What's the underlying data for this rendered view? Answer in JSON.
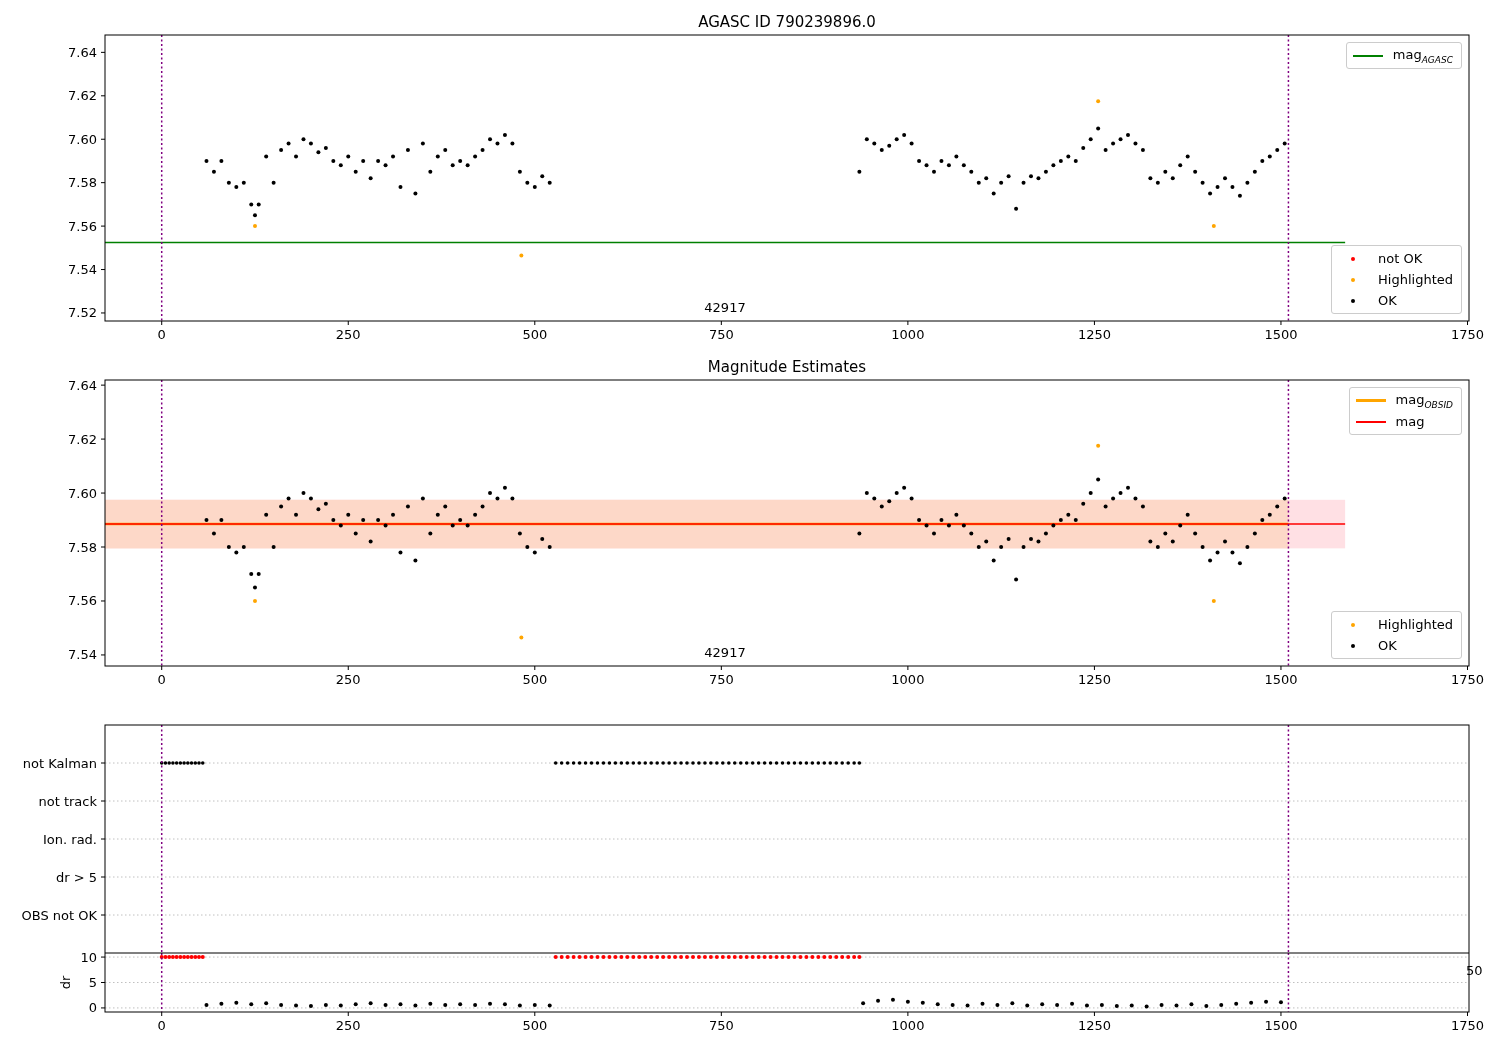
{
  "charts": [
    {
      "chart_data": {
        "type": "scatter",
        "title": "AGASC ID 790239896.0",
        "xlim": [
          -76,
          1752
        ],
        "ylim": [
          7.5163,
          7.648
        ],
        "xticks": [
          0,
          250,
          500,
          750,
          1000,
          1250,
          1500,
          1750
        ],
        "yticks": [
          {
            "value": 7.52,
            "label": "7.52"
          },
          {
            "value": 7.54,
            "label": "7.54"
          },
          {
            "value": 7.56,
            "label": "7.56"
          },
          {
            "value": 7.58,
            "label": "7.58"
          },
          {
            "value": 7.6,
            "label": "7.60"
          },
          {
            "value": 7.62,
            "label": "7.62"
          },
          {
            "value": 7.64,
            "label": "7.64"
          }
        ],
        "ref_lines": [
          {
            "axis": "y",
            "value": 7.5525,
            "label": "mag$_{AGASC}$",
            "color": "#008000"
          },
          {
            "axis": "x",
            "value": 0,
            "color": "#800080"
          },
          {
            "axis": "x",
            "value": 1510,
            "color": "#800080"
          }
        ],
        "series": [
          {
            "name": "not OK",
            "color": "#ff0000"
          },
          {
            "name": "Highlighted",
            "color": "#ffa500",
            "x": [
              125,
              482,
              1255,
              1410
            ],
            "values": [
              7.56,
              7.5465,
              7.6175,
              7.56
            ]
          },
          {
            "name": "OK",
            "color": "#000000",
            "x": [
              60,
              70,
              80,
              90,
              100,
              110,
              120,
              125,
              130,
              140,
              150,
              160,
              170,
              180,
              190,
              200,
              210,
              220,
              230,
              240,
              250,
              260,
              270,
              280,
              290,
              300,
              310,
              320,
              330,
              340,
              350,
              360,
              370,
              380,
              390,
              400,
              410,
              420,
              430,
              440,
              450,
              460,
              470,
              480,
              490,
              500,
              510,
              520,
              935,
              945,
              955,
              965,
              975,
              985,
              995,
              1005,
              1015,
              1025,
              1035,
              1045,
              1055,
              1065,
              1075,
              1085,
              1095,
              1105,
              1115,
              1125,
              1135,
              1145,
              1155,
              1165,
              1175,
              1185,
              1195,
              1205,
              1215,
              1225,
              1235,
              1245,
              1255,
              1265,
              1275,
              1285,
              1295,
              1305,
              1315,
              1325,
              1335,
              1345,
              1355,
              1365,
              1375,
              1385,
              1395,
              1405,
              1415,
              1425,
              1435,
              1445,
              1455,
              1465,
              1475,
              1485,
              1495,
              1505
            ],
            "values": [
              7.59,
              7.585,
              7.59,
              7.58,
              7.578,
              7.58,
              7.57,
              7.565,
              7.57,
              7.592,
              7.58,
              7.595,
              7.598,
              7.592,
              7.6,
              7.598,
              7.594,
              7.596,
              7.59,
              7.588,
              7.592,
              7.585,
              7.59,
              7.582,
              7.59,
              7.588,
              7.592,
              7.578,
              7.595,
              7.575,
              7.598,
              7.585,
              7.592,
              7.595,
              7.588,
              7.59,
              7.588,
              7.592,
              7.595,
              7.6,
              7.598,
              7.602,
              7.598,
              7.585,
              7.58,
              7.578,
              7.583,
              7.58,
              7.585,
              7.6,
              7.598,
              7.595,
              7.597,
              7.6,
              7.602,
              7.598,
              7.59,
              7.588,
              7.585,
              7.59,
              7.588,
              7.592,
              7.588,
              7.585,
              7.58,
              7.582,
              7.575,
              7.58,
              7.583,
              7.568,
              7.58,
              7.583,
              7.582,
              7.585,
              7.588,
              7.59,
              7.592,
              7.59,
              7.596,
              7.6,
              7.605,
              7.595,
              7.598,
              7.6,
              7.602,
              7.598,
              7.595,
              7.582,
              7.58,
              7.585,
              7.582,
              7.588,
              7.592,
              7.585,
              7.58,
              7.575,
              7.578,
              7.582,
              7.578,
              7.574,
              7.58,
              7.585,
              7.59,
              7.592,
              7.595,
              7.598
            ]
          }
        ],
        "annotations": [
          "42917"
        ]
      }
    },
    {
      "chart_data": {
        "type": "scatter",
        "title": "Magnitude Estimates",
        "xlim": [
          -76,
          1752
        ],
        "ylim": [
          7.5359,
          7.6419
        ],
        "xticks": [
          0,
          250,
          500,
          750,
          1000,
          1250,
          1500,
          1750
        ],
        "yticks": [
          {
            "value": 7.54,
            "label": "7.54"
          },
          {
            "value": 7.56,
            "label": "7.56"
          },
          {
            "value": 7.58,
            "label": "7.58"
          },
          {
            "value": 7.6,
            "label": "7.60"
          },
          {
            "value": 7.62,
            "label": "7.62"
          },
          {
            "value": 7.64,
            "label": "7.64"
          }
        ],
        "ref_lines": [
          {
            "axis": "y",
            "value": 7.5885,
            "label": "mag$_{OBSID}$",
            "color": "#ffa500"
          },
          {
            "axis": "y",
            "value": 7.5885,
            "label": "mag",
            "color": "#ff0000"
          },
          {
            "axis": "x",
            "value": 0,
            "color": "#800080"
          },
          {
            "axis": "x",
            "value": 1510,
            "color": "#800080"
          }
        ],
        "bands": [
          {
            "axis": "y",
            "from": 7.5795,
            "to": 7.5975,
            "color": "#ffe0e4"
          },
          {
            "axis": "y",
            "from": 7.5795,
            "to": 7.5975,
            "color": "#fdd8c8"
          }
        ],
        "series": [
          {
            "name": "Highlighted",
            "color": "#ffa500",
            "x": [
              125,
              482,
              1255,
              1410
            ],
            "values": [
              7.56,
              7.5465,
              7.6175,
              7.56
            ]
          },
          {
            "name": "OK",
            "color": "#000000",
            "x": [
              60,
              70,
              80,
              90,
              100,
              110,
              120,
              125,
              130,
              140,
              150,
              160,
              170,
              180,
              190,
              200,
              210,
              220,
              230,
              240,
              250,
              260,
              270,
              280,
              290,
              300,
              310,
              320,
              330,
              340,
              350,
              360,
              370,
              380,
              390,
              400,
              410,
              420,
              430,
              440,
              450,
              460,
              470,
              480,
              490,
              500,
              510,
              520,
              935,
              945,
              955,
              965,
              975,
              985,
              995,
              1005,
              1015,
              1025,
              1035,
              1045,
              1055,
              1065,
              1075,
              1085,
              1095,
              1105,
              1115,
              1125,
              1135,
              1145,
              1155,
              1165,
              1175,
              1185,
              1195,
              1205,
              1215,
              1225,
              1235,
              1245,
              1255,
              1265,
              1275,
              1285,
              1295,
              1305,
              1315,
              1325,
              1335,
              1345,
              1355,
              1365,
              1375,
              1385,
              1395,
              1405,
              1415,
              1425,
              1435,
              1445,
              1455,
              1465,
              1475,
              1485,
              1495,
              1505
            ],
            "values": [
              7.59,
              7.585,
              7.59,
              7.58,
              7.578,
              7.58,
              7.57,
              7.565,
              7.57,
              7.592,
              7.58,
              7.595,
              7.598,
              7.592,
              7.6,
              7.598,
              7.594,
              7.596,
              7.59,
              7.588,
              7.592,
              7.585,
              7.59,
              7.582,
              7.59,
              7.588,
              7.592,
              7.578,
              7.595,
              7.575,
              7.598,
              7.585,
              7.592,
              7.595,
              7.588,
              7.59,
              7.588,
              7.592,
              7.595,
              7.6,
              7.598,
              7.602,
              7.598,
              7.585,
              7.58,
              7.578,
              7.583,
              7.58,
              7.585,
              7.6,
              7.598,
              7.595,
              7.597,
              7.6,
              7.602,
              7.598,
              7.59,
              7.588,
              7.585,
              7.59,
              7.588,
              7.592,
              7.588,
              7.585,
              7.58,
              7.582,
              7.575,
              7.58,
              7.583,
              7.568,
              7.58,
              7.583,
              7.582,
              7.585,
              7.588,
              7.59,
              7.592,
              7.59,
              7.596,
              7.6,
              7.605,
              7.595,
              7.598,
              7.6,
              7.602,
              7.598,
              7.595,
              7.582,
              7.58,
              7.585,
              7.582,
              7.588,
              7.592,
              7.585,
              7.58,
              7.575,
              7.578,
              7.582,
              7.578,
              7.574,
              7.58,
              7.585,
              7.59,
              7.592,
              7.595,
              7.598
            ]
          }
        ],
        "annotations": [
          "42917"
        ]
      }
    },
    {
      "flag_rows": [
        "not Kalman",
        "not track",
        "Ion. rad.",
        "dr > 5",
        "OBS not OK"
      ]
    },
    {
      "chart_data": {
        "type": "scatter",
        "grid": true,
        "ylabel": "dr",
        "xlim": [
          -76,
          1752
        ],
        "ylim": [
          -0.8,
          10.8
        ],
        "xticks": [
          0,
          250,
          500,
          750,
          1000,
          1250,
          1500,
          1750
        ],
        "yticks": [
          0,
          5,
          10
        ],
        "ref_lines": [
          {
            "axis": "x",
            "value": 0,
            "color": "#800080"
          },
          {
            "axis": "x",
            "value": 1510,
            "color": "#800080"
          }
        ],
        "series": [
          {
            "color": "#ff0000",
            "x": [
              0,
              5,
              10,
              15,
              20,
              25,
              30,
              35,
              40,
              45,
              50,
              55,
              528,
              536,
              544,
              552,
              560,
              568,
              576,
              584,
              592,
              600,
              608,
              616,
              624,
              632,
              640,
              648,
              656,
              664,
              672,
              680,
              688,
              696,
              704,
              712,
              720,
              728,
              736,
              744,
              752,
              760,
              768,
              776,
              784,
              792,
              800,
              808,
              816,
              824,
              832,
              840,
              848,
              856,
              864,
              872,
              880,
              888,
              896,
              904,
              912,
              920,
              928,
              935
            ],
            "values": [
              10,
              10,
              10,
              10,
              10,
              10,
              10,
              10,
              10,
              10,
              10,
              10,
              10,
              10,
              10,
              10,
              10,
              10,
              10,
              10,
              10,
              10,
              10,
              10,
              10,
              10,
              10,
              10,
              10,
              10,
              10,
              10,
              10,
              10,
              10,
              10,
              10,
              10,
              10,
              10,
              10,
              10,
              10,
              10,
              10,
              10,
              10,
              10,
              10,
              10,
              10,
              10,
              10,
              10,
              10,
              10,
              10,
              10,
              10,
              10,
              10,
              10,
              10,
              10
            ]
          },
          {
            "color": "#000000",
            "x": [
              60,
              80,
              100,
              120,
              140,
              160,
              180,
              200,
              220,
              240,
              260,
              280,
              300,
              320,
              340,
              360,
              380,
              400,
              420,
              440,
              460,
              480,
              500,
              520,
              940,
              960,
              980,
              1000,
              1020,
              1040,
              1060,
              1080,
              1100,
              1120,
              1140,
              1160,
              1180,
              1200,
              1220,
              1240,
              1260,
              1280,
              1300,
              1320,
              1340,
              1360,
              1380,
              1400,
              1420,
              1440,
              1460,
              1480,
              1500
            ],
            "values": [
              0.6,
              0.8,
              1.0,
              0.7,
              0.9,
              0.6,
              0.5,
              0.4,
              0.6,
              0.5,
              0.7,
              0.9,
              0.6,
              0.7,
              0.5,
              0.8,
              0.6,
              0.7,
              0.6,
              0.8,
              0.7,
              0.5,
              0.6,
              0.5,
              0.9,
              1.4,
              1.6,
              1.2,
              1.0,
              0.7,
              0.6,
              0.5,
              0.8,
              0.6,
              0.9,
              0.5,
              0.7,
              0.6,
              0.8,
              0.5,
              0.6,
              0.4,
              0.5,
              0.3,
              0.6,
              0.5,
              0.7,
              0.4,
              0.6,
              0.8,
              1.0,
              1.2,
              1.1
            ]
          }
        ],
        "annotations": [
          "50"
        ]
      }
    }
  ]
}
